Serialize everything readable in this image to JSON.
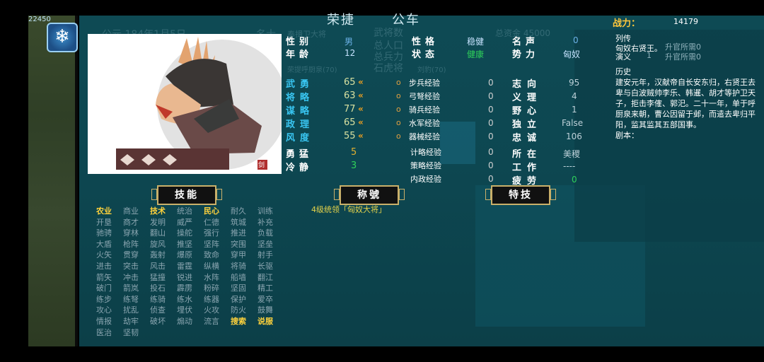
{
  "counter": "22450",
  "header": {
    "title_left": "荣捷",
    "title_right": "公车"
  },
  "ghost_text": {
    "era": "公元 184年1月5日",
    "shi": "名士",
    "rank_line": "奉揖卫大将",
    "total_officers": "武将数",
    "pop_line": "总人口",
    "troops_line": "总兵力",
    "stone": "石虎将",
    "gold": "总资金 45000",
    "cap": "荣提呼厨泉(70)",
    "cap2": "刘豹(70)"
  },
  "portrait": {
    "seal": "剑"
  },
  "attributes": {
    "gender_label": "性别",
    "gender": "男",
    "age_label": "年龄",
    "age": "12",
    "personality_label": "性格",
    "personality": "稳健",
    "status_label": "状态",
    "status": "健康",
    "fame_label": "名声",
    "fame": "0",
    "faction_label": "势力",
    "faction": "匈奴"
  },
  "stats": [
    {
      "label": "武勇",
      "value": "65",
      "arrow": "«",
      "exp_label": "步兵经验",
      "exp": "0"
    },
    {
      "label": "将略",
      "value": "63",
      "arrow": "«",
      "exp_label": "弓弩经验",
      "exp": "0"
    },
    {
      "label": "谋略",
      "value": "77",
      "arrow": "«",
      "exp_label": "骑兵经验",
      "exp": "0"
    },
    {
      "label": "政理",
      "value": "65",
      "arrow": "«",
      "exp_label": "水军经验",
      "exp": "0"
    },
    {
      "label": "风度",
      "value": "55",
      "arrow": "«",
      "exp_label": "器械经验",
      "exp": "0"
    }
  ],
  "extra_stats": [
    {
      "label": "勇猛",
      "value": "5",
      "exp_label": "计略经验",
      "exp": "0"
    },
    {
      "label": "冷静",
      "value": "3",
      "exp_label": "策略经验",
      "exp": "0"
    },
    {
      "label": "",
      "value": "",
      "exp_label": "内政经验",
      "exp": "0"
    }
  ],
  "stat_o": "o",
  "right_attrs": [
    {
      "label": "志向",
      "value": "95"
    },
    {
      "label": "义理",
      "value": "4"
    },
    {
      "label": "野心",
      "value": "1"
    },
    {
      "label": "独立",
      "value": "False"
    },
    {
      "label": "忠诚",
      "value": "106"
    },
    {
      "label": "所在",
      "value": "美稷"
    },
    {
      "label": "工作",
      "value": "----"
    },
    {
      "label": "疲劳",
      "value": "0"
    }
  ],
  "buttons": {
    "skills": "技能",
    "titles": "称號",
    "special": "特技"
  },
  "title_desc": "4级统领「匈奴大将」",
  "skills": [
    [
      "农业",
      "商业",
      "技术",
      "统治",
      "民心",
      "耐久",
      "训练"
    ],
    [
      "开垦",
      "商才",
      "发明",
      "威严",
      "仁德",
      "筑城",
      "补充"
    ],
    [
      "驰骋",
      "穿林",
      "翻山",
      "操舵",
      "强行",
      "推进",
      "负载"
    ],
    [
      "大盾",
      "枪阵",
      "旋风",
      "推坚",
      "坚阵",
      "突围",
      "坚垒"
    ],
    [
      "火矢",
      "贯穿",
      "轰射",
      "爆原",
      "致命",
      "穿甲",
      "射手"
    ],
    [
      "进击",
      "突击",
      "风击",
      "雷霆",
      "纵横",
      "将骑",
      "长驱"
    ],
    [
      "箭矢",
      "冲击",
      "猛撞",
      "锐进",
      "水阵",
      "船墙",
      "翻江"
    ],
    [
      "破门",
      "箭岚",
      "投石",
      "霹雳",
      "粉碎",
      "坚固",
      "精工"
    ],
    [
      "练步",
      "练弩",
      "练骑",
      "练水",
      "练器",
      "保护",
      "爱卒"
    ],
    [
      "攻心",
      "扰乱",
      "侦查",
      "埋伏",
      "火攻",
      "防火",
      "鼓舞"
    ],
    [
      "情报",
      "劫牢",
      "破坏",
      "煽动",
      "流言",
      "搜索",
      "说服"
    ],
    [
      "医治",
      "坚韧"
    ]
  ],
  "skill_highlights": [
    "农业",
    "技术",
    "民心",
    "搜索",
    "说服"
  ],
  "right_panel": {
    "battle_label": "战力：",
    "battle_value": "14179",
    "biography_label": "列传",
    "biography": "匈奴右贤王。",
    "novel_label": "演义",
    "rank1": "升官所需0",
    "rank2": "升官所需0",
    "rank_num": "1",
    "history_label": "历史",
    "history": "建安元年，汉献帝自长安东归，右贤王去卑与白波贼帅李乐、韩暹、胡才等护卫天子，拒击李傕、郭汜。二十一年，单于呼厨泉来朝，曹公因留于邺，而遣去卑归平阳，监其监其五部国事。",
    "script_label": "剧本："
  },
  "colors": {
    "stat_label": "#39c6f2",
    "highlight": "#ffd23c",
    "map": "#0e4a54"
  }
}
